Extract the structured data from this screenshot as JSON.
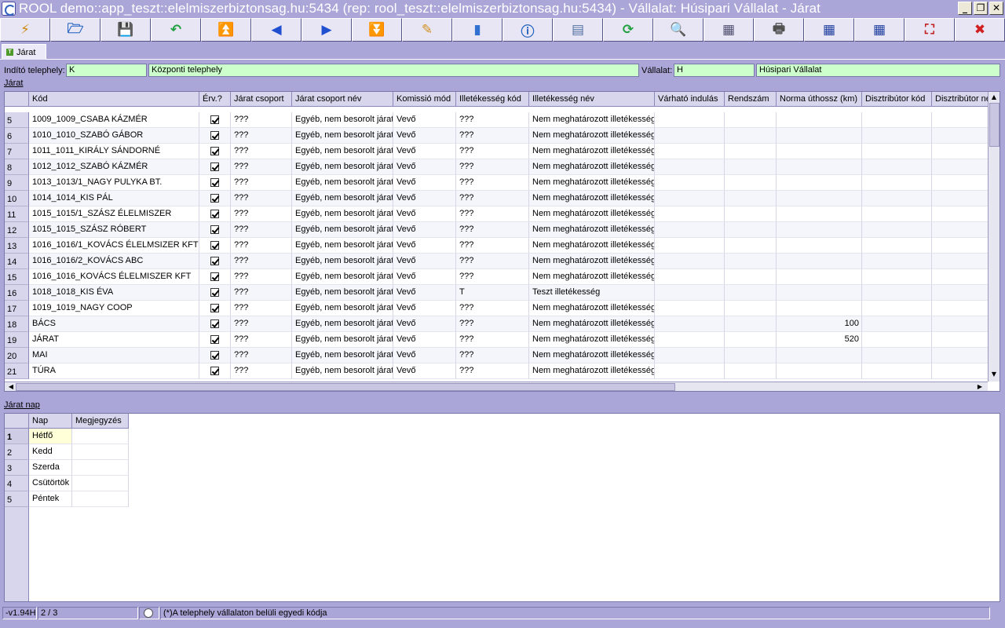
{
  "window": {
    "title": "ROOL demo::app_teszt::elelmiszerbiztonsag.hu:5434 (rep: rool_teszt::elelmiszerbiztonsag.hu:5434) - Vállalat: Húsipari Vállalat - Járat",
    "min_label": "_",
    "max_label": "❐",
    "close_label": "✕"
  },
  "toolbar": {
    "buttons": [
      {
        "name": "lightning-icon",
        "glyph": "⚡",
        "color": "#d08a10"
      },
      {
        "name": "open-folder-icon",
        "glyph": "🗁",
        "color": "#2060c0"
      },
      {
        "name": "save-icon",
        "glyph": "💾",
        "color": "#3050a0"
      },
      {
        "name": "undo-icon",
        "glyph": "↶",
        "color": "#20a040"
      },
      {
        "name": "first-record-icon",
        "glyph": "⏫",
        "color": "#2050d0"
      },
      {
        "name": "previous-record-icon",
        "glyph": "◀",
        "color": "#2050d0"
      },
      {
        "name": "next-record-icon",
        "glyph": "▶",
        "color": "#2050d0"
      },
      {
        "name": "last-record-icon",
        "glyph": "⏬",
        "color": "#2050d0"
      },
      {
        "name": "edit-icon",
        "glyph": "✎",
        "color": "#d09020"
      },
      {
        "name": "database-icon",
        "glyph": "▮",
        "color": "#3070d0"
      },
      {
        "name": "info-icon",
        "glyph": "ⓘ",
        "color": "#2060c0"
      },
      {
        "name": "form-view-icon",
        "glyph": "▤",
        "color": "#5070a0"
      },
      {
        "name": "refresh-icon",
        "glyph": "⟳",
        "color": "#20a040"
      },
      {
        "name": "search-icon",
        "glyph": "🔍",
        "color": "#405080"
      },
      {
        "name": "table-view-icon",
        "glyph": "▦",
        "color": "#505070"
      },
      {
        "name": "print-icon",
        "glyph": "🖶",
        "color": "#505050"
      },
      {
        "name": "grid-export-icon",
        "glyph": "▦",
        "color": "#2040a0"
      },
      {
        "name": "grid-settings-icon",
        "glyph": "▦",
        "color": "#2040a0"
      },
      {
        "name": "fullscreen-icon",
        "glyph": "⛶",
        "color": "#c02020"
      },
      {
        "name": "close-icon",
        "glyph": "✖",
        "color": "#d02020"
      }
    ]
  },
  "tab": {
    "label": "Járat",
    "icon_text": "T"
  },
  "header": {
    "telephely_label": "Indító telephely:",
    "telephely_code": "K",
    "telephely_name": "Központi telephely",
    "vallalat_label": "Vállalat:",
    "vallalat_code": "H",
    "vallalat_name": "Húsipari Vállalat"
  },
  "jarat": {
    "section_label": "Járat",
    "columns": [
      "Kód",
      "Érv.?",
      "Járat csoport",
      "Járat csoport név",
      "Komissió mód",
      "Illetékesség kód",
      "Illetékesség név",
      "Várható indulás",
      "Rendszám",
      "Norma úthossz (km)",
      "Disztribútor kód",
      "Disztribútor név"
    ],
    "rows": [
      {
        "idx": "5",
        "kod": "1009_1009_CSABA KÁZMÉR",
        "csop": "???",
        "csopnev": "Egyéb, nem besorolt járat",
        "kom": "Vevő",
        "ilkod": "???",
        "ilnev": "Nem meghatározott illetékesség",
        "km": ""
      },
      {
        "idx": "6",
        "kod": "1010_1010_SZABÓ GÁBOR",
        "csop": "???",
        "csopnev": "Egyéb, nem besorolt járat",
        "kom": "Vevő",
        "ilkod": "???",
        "ilnev": "Nem meghatározott illetékesség",
        "km": ""
      },
      {
        "idx": "7",
        "kod": "1011_1011_KIRÁLY SÁNDORNÉ",
        "csop": "???",
        "csopnev": "Egyéb, nem besorolt járat",
        "kom": "Vevő",
        "ilkod": "???",
        "ilnev": "Nem meghatározott illetékesség",
        "km": ""
      },
      {
        "idx": "8",
        "kod": "1012_1012_SZABÓ KÁZMÉR",
        "csop": "???",
        "csopnev": "Egyéb, nem besorolt járat",
        "kom": "Vevő",
        "ilkod": "???",
        "ilnev": "Nem meghatározott illetékesség",
        "km": ""
      },
      {
        "idx": "9",
        "kod": "1013_1013/1_NAGY PULYKA BT.",
        "csop": "???",
        "csopnev": "Egyéb, nem besorolt járat",
        "kom": "Vevő",
        "ilkod": "???",
        "ilnev": "Nem meghatározott illetékesség",
        "km": ""
      },
      {
        "idx": "10",
        "kod": "1014_1014_KIS PÁL",
        "csop": "???",
        "csopnev": "Egyéb, nem besorolt járat",
        "kom": "Vevő",
        "ilkod": "???",
        "ilnev": "Nem meghatározott illetékesség",
        "km": ""
      },
      {
        "idx": "11",
        "kod": "1015_1015/1_SZÁSZ ÉLELMISZER",
        "csop": "???",
        "csopnev": "Egyéb, nem besorolt járat",
        "kom": "Vevő",
        "ilkod": "???",
        "ilnev": "Nem meghatározott illetékesség",
        "km": ""
      },
      {
        "idx": "12",
        "kod": "1015_1015_SZÁSZ RÓBERT",
        "csop": "???",
        "csopnev": "Egyéb, nem besorolt járat",
        "kom": "Vevő",
        "ilkod": "???",
        "ilnev": "Nem meghatározott illetékesség",
        "km": ""
      },
      {
        "idx": "13",
        "kod": "1016_1016/1_KOVÁCS ÉLELMSIZER KFT",
        "csop": "???",
        "csopnev": "Egyéb, nem besorolt járat",
        "kom": "Vevő",
        "ilkod": "???",
        "ilnev": "Nem meghatározott illetékesség",
        "km": ""
      },
      {
        "idx": "14",
        "kod": "1016_1016/2_KOVÁCS ABC",
        "csop": "???",
        "csopnev": "Egyéb, nem besorolt járat",
        "kom": "Vevő",
        "ilkod": "???",
        "ilnev": "Nem meghatározott illetékesség",
        "km": ""
      },
      {
        "idx": "15",
        "kod": "1016_1016_KOVÁCS ÉLELMISZER KFT",
        "csop": "???",
        "csopnev": "Egyéb, nem besorolt járat",
        "kom": "Vevő",
        "ilkod": "???",
        "ilnev": "Nem meghatározott illetékesség",
        "km": ""
      },
      {
        "idx": "16",
        "kod": "1018_1018_KIS ÉVA",
        "csop": "???",
        "csopnev": "Egyéb, nem besorolt járat",
        "kom": "Vevő",
        "ilkod": "T",
        "ilnev": "Teszt illetékesség",
        "km": ""
      },
      {
        "idx": "17",
        "kod": "1019_1019_NAGY COOP",
        "csop": "???",
        "csopnev": "Egyéb, nem besorolt járat",
        "kom": "Vevő",
        "ilkod": "???",
        "ilnev": "Nem meghatározott illetékesség",
        "km": ""
      },
      {
        "idx": "18",
        "kod": "BÁCS",
        "csop": "???",
        "csopnev": "Egyéb, nem besorolt járat",
        "kom": "Vevő",
        "ilkod": "???",
        "ilnev": "Nem meghatározott illetékesség",
        "km": "100"
      },
      {
        "idx": "19",
        "kod": "JÁRAT",
        "csop": "???",
        "csopnev": "Egyéb, nem besorolt járat",
        "kom": "Vevő",
        "ilkod": "???",
        "ilnev": "Nem meghatározott illetékesség",
        "km": "520"
      },
      {
        "idx": "20",
        "kod": "MAI",
        "csop": "???",
        "csopnev": "Egyéb, nem besorolt járat",
        "kom": "Vevő",
        "ilkod": "???",
        "ilnev": "Nem meghatározott illetékesség",
        "km": ""
      },
      {
        "idx": "21",
        "kod": "TÚRA",
        "csop": "???",
        "csopnev": "Egyéb, nem besorolt járat",
        "kom": "Vevő",
        "ilkod": "???",
        "ilnev": "Nem meghatározott illetékesség",
        "km": ""
      }
    ]
  },
  "jaratnap": {
    "section_label": "Járat nap",
    "columns": [
      "Nap",
      "Megjegyzés"
    ],
    "rows": [
      {
        "idx": "1",
        "nap": "Hétfő",
        "megj": ""
      },
      {
        "idx": "2",
        "nap": "Kedd",
        "megj": ""
      },
      {
        "idx": "3",
        "nap": "Szerda",
        "megj": ""
      },
      {
        "idx": "4",
        "nap": "Csütörtök",
        "megj": ""
      },
      {
        "idx": "5",
        "nap": "Péntek",
        "megj": ""
      }
    ]
  },
  "status": {
    "version": "-v1.94H",
    "record": "2 / 3",
    "message": "(*)A telephely vállalaton belüli egyedi kódja"
  }
}
